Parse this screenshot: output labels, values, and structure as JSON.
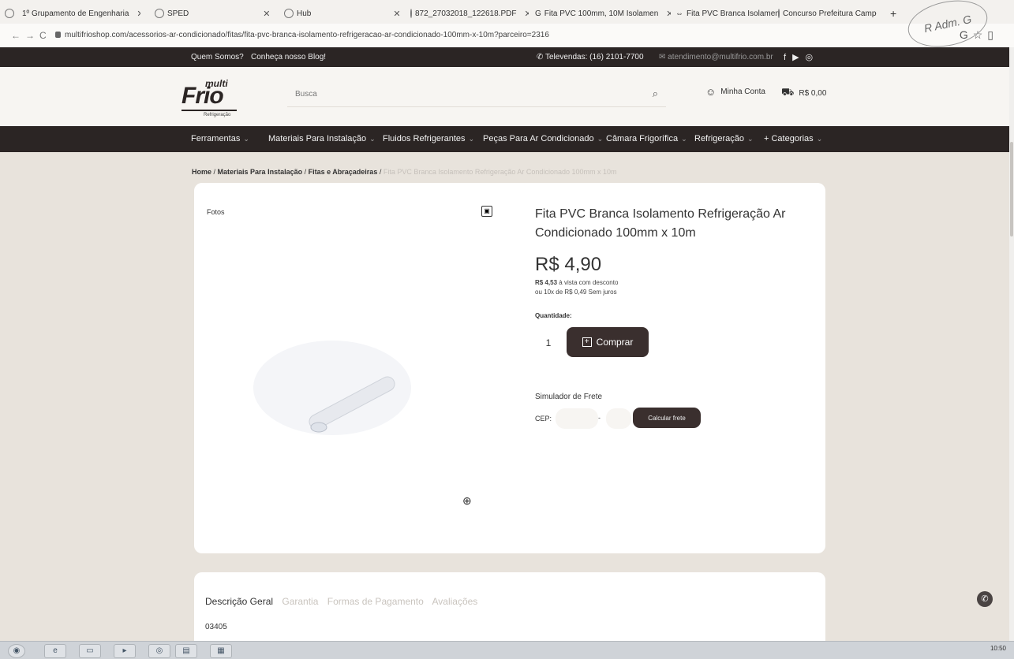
{
  "browser": {
    "tabs": [
      {
        "label": "1º Grupamento de Engenharia"
      },
      {
        "label": "SPED"
      },
      {
        "label": "Hub"
      },
      {
        "label": "872_27032018_122618.PDF"
      },
      {
        "label": "Fita PVC 100mm, 10M Isolamen"
      },
      {
        "label": "Fita PVC Branca Isolamento Ref"
      },
      {
        "label": "Concurso Prefeitura Campo"
      }
    ],
    "url": "multifrioshop.com/acessorios-ar-condicionado/fitas/fita-pvc-branca-isolamento-refrigeracao-ar-condicionado-100mm-x-10m?parceiro=2316"
  },
  "topbar": {
    "quem_somos": "Quem Somos?",
    "blog": "Conheça nosso Blog!",
    "televendas": "Televendas: (16) 2101-7700",
    "email": "atendimento@multifrio.com.br"
  },
  "header": {
    "logo_multi": "multi",
    "logo_frio": "Frio",
    "logo_sub": "Refrigeração",
    "search_placeholder": "Busca",
    "account": "Minha Conta",
    "cart": "R$ 0,00"
  },
  "menu": [
    {
      "label": "Ferramentas"
    },
    {
      "label": "Materiais Para Instalação"
    },
    {
      "label": "Fluidos Refrigerantes"
    },
    {
      "label": "Peças Para Ar Condicionado"
    },
    {
      "label": "Câmara Frigorífica"
    },
    {
      "label": "Refrigeração"
    },
    {
      "label": "+ Categorias"
    }
  ],
  "breadcrumb": {
    "home": "Home",
    "cat": "Materiais Para Instalação",
    "sub": "Fitas e Abraçadeiras",
    "current": "Fita PVC Branca Isolamento Refrigeração Ar Condicionado 100mm x 10m"
  },
  "product": {
    "fotos_label": "Fotos",
    "title": "Fita PVC Branca Isolamento Refrigeração Ar Condicionado 100mm x 10m",
    "price": "R$ 4,90",
    "pix_value": "R$ 4,53",
    "pix_text": "à vista com desconto",
    "installments": "ou 10x de R$ 0,49 Sem juros",
    "qty_label": "Quantidade:",
    "qty_value": "1",
    "buy_label": "Comprar",
    "frete_title": "Simulador de Frete",
    "cep_label": "CEP:",
    "calc_label": "Calcular frete"
  },
  "details": {
    "tabs": [
      "Descrição Geral",
      "Garantia",
      "Formas de Pagamento",
      "Avaliações"
    ],
    "sku": "03405"
  },
  "stamp_text": "R Adm. G",
  "taskbar": {
    "time": "10:50"
  }
}
